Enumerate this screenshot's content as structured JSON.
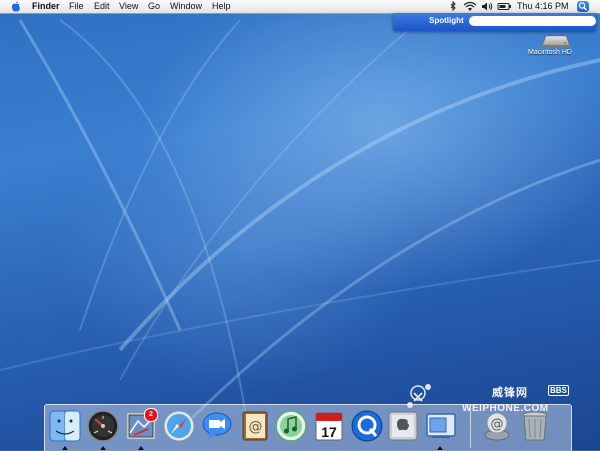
{
  "menubar": {
    "apple_icon": "apple-icon",
    "app_name": "Finder",
    "menus": [
      "File",
      "Edit",
      "View",
      "Go",
      "Window",
      "Help"
    ],
    "status_icons": [
      "bluetooth-icon",
      "airport-wifi-icon",
      "volume-icon",
      "battery-icon"
    ],
    "clock": "Thu 4:16 PM",
    "spotlight_icon": "spotlight-magnifier-icon"
  },
  "spotlight": {
    "label": "Spotlight",
    "query": ""
  },
  "desktop": {
    "volume_label": "Macintosh HD"
  },
  "watermark": {
    "chinese": "威锋网",
    "bbs": "BBS",
    "site": "WEIPHONE.COM"
  },
  "dock": {
    "items": [
      {
        "icon": "finder-icon",
        "running": true
      },
      {
        "icon": "dashboard-icon",
        "running": true
      },
      {
        "icon": "mail-icon",
        "running": true,
        "badge": "2"
      },
      {
        "icon": "safari-icon",
        "running": false
      },
      {
        "icon": "ichat-icon",
        "running": false
      },
      {
        "icon": "address-book-icon",
        "running": false
      },
      {
        "icon": "itunes-icon",
        "running": false
      },
      {
        "icon": "ical-icon",
        "running": false,
        "date": "17"
      },
      {
        "icon": "quicktime-icon",
        "running": false
      },
      {
        "icon": "system-preferences-icon",
        "running": false
      },
      {
        "icon": "preview-icon",
        "running": true
      },
      {
        "icon": "downloads-stack-icon",
        "running": false
      },
      {
        "icon": "trash-icon",
        "running": false
      }
    ]
  },
  "colors": {
    "desktop_blue": "#2a63b8",
    "spotlight_blue": "#1d56c6",
    "badge_red": "#e3151a"
  }
}
